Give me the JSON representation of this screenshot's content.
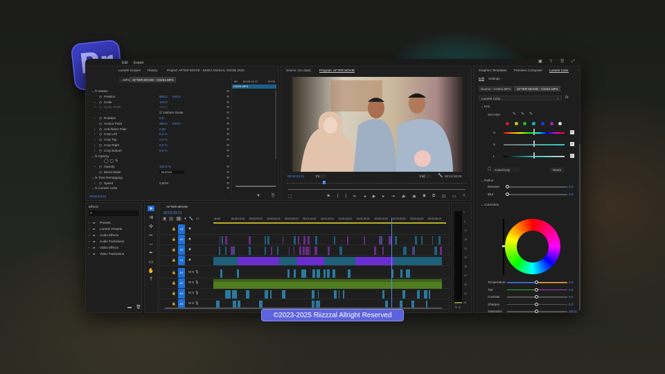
{
  "app": {
    "logo_text": "Pr",
    "menu": [
      "Edit",
      "Export"
    ]
  },
  "effect_controls": {
    "tabs": [
      "Lumetri Scopes",
      "History",
      "Project: AFTER MOVIE - MUDA ANNUAL SHOW 2025"
    ],
    "source_chip": "...MP4",
    "clip_chip": "AFTER MOVIE - C0251.MP4",
    "mini_ruler": [
      ":00",
      "00:00:11:12",
      "00:00"
    ],
    "mini_clip": "C0251.MP4",
    "rows": [
      {
        "n": "Motion",
        "fx": true
      },
      {
        "n": "Position",
        "v": "960,0",
        "v2": "540,0"
      },
      {
        "n": "Scale",
        "v": "100,0",
        "exp": true
      },
      {
        "n": "Scale Width",
        "v": "100,0",
        "exp": true,
        "dim": true
      },
      {
        "n": "",
        "v": "Uniform Scale",
        "check": true
      },
      {
        "n": "Rotation",
        "v": "0,0",
        "exp": true
      },
      {
        "n": "Anchor Point",
        "v": "960,0",
        "v2": "540,0"
      },
      {
        "n": "Anti-flicker Filter",
        "v": "0,00",
        "exp": true
      },
      {
        "n": "Crop Left",
        "v": "0,0 %",
        "exp": true
      },
      {
        "n": "Crop Top",
        "v": "0,0 %",
        "exp": true
      },
      {
        "n": "Crop Right",
        "v": "0,0 %",
        "exp": true
      },
      {
        "n": "Crop Bottom",
        "v": "0,0 %",
        "exp": true
      },
      {
        "n": "Opacity",
        "fx": true
      },
      {
        "n": "",
        "masks": true
      },
      {
        "n": "Opacity",
        "v": "100,0 %",
        "exp": true
      },
      {
        "n": "Blend Mode",
        "v": "Normal",
        "select": true
      },
      {
        "n": "Time Remapping",
        "fx": true
      },
      {
        "n": "Speed",
        "v": "0,00%",
        "exp": true,
        "white": true
      },
      {
        "n": "Lumetri Color",
        "fx": true
      }
    ],
    "timecode": "00:02:23:21"
  },
  "program": {
    "tabs": [
      "Source: (no clips)",
      "Program: AFTER MOVIE"
    ],
    "timecode": "00:02:23:21",
    "zoom": "Fit",
    "quality": "Full",
    "duration": "00:12:16:10",
    "playhead_fraction": 0.2
  },
  "lumetri": {
    "tabs": [
      "Graphics Templates",
      "Premiere Composer",
      "Lumetri Color"
    ],
    "subtabs": [
      "Edit",
      "Settings"
    ],
    "source": "Source - C0251.MP4",
    "clip": "AFTER MOVIE - C0251.MP4",
    "effect": "Lumetri Color",
    "key_label": "Key",
    "set_color": "Set color",
    "swatches": [
      "#c0202a",
      "#c6c21f",
      "#2db33a",
      "#1fb5b5",
      "#2435e0",
      "#a520c0",
      "#d8d8d8"
    ],
    "hsl": [
      "H",
      "S",
      "L"
    ],
    "mode": "Color/Gray",
    "reset": "Reset",
    "refine_label": "Refine",
    "refine": [
      {
        "n": "Denoise",
        "v": "0,0"
      },
      {
        "n": "Blur",
        "v": "0,0"
      }
    ],
    "correction_label": "Correction",
    "correction": [
      {
        "n": "Temperature",
        "v": "0,0"
      },
      {
        "n": "Tint",
        "v": "0,0"
      },
      {
        "n": "Contrast",
        "v": "0,0"
      },
      {
        "n": "Sharpen",
        "v": "0,0"
      },
      {
        "n": "Saturation",
        "v": "100,0"
      }
    ]
  },
  "effects": {
    "title": "Effects",
    "items": [
      "Presets",
      "Lumetri Presets",
      "Audio Effects",
      "Audio Transitions",
      "Video Effects",
      "Video Transitions"
    ]
  },
  "timeline": {
    "title": "AFTER MOVIE",
    "timecode": "00:02:23:21",
    "ruler": [
      ":00:00",
      "00:00:14:23",
      "00:00:29:23",
      "00:00:44:22",
      "00:00:59:22",
      "00:01:14:22",
      "00:01:29:21",
      "00:01:44:21",
      "00:01:59:21",
      "00:02:14:20",
      "00:02:29:20",
      "00:02:44:20",
      "00:02:59:19"
    ],
    "tracks": [
      "V4",
      "V3",
      "V2",
      "V1",
      "A1",
      "A2",
      "A3",
      "A4"
    ],
    "playhead_fraction": 0.765
  },
  "meter": {
    "scale": [
      "0",
      "-6",
      "-12",
      "-18",
      "-24",
      "-30",
      "-36",
      "-42",
      "-48",
      "-54",
      "dB"
    ],
    "channels": [
      "S",
      "S"
    ]
  },
  "watermark": "©2023-2025 Riizzzal Allright Reserved"
}
